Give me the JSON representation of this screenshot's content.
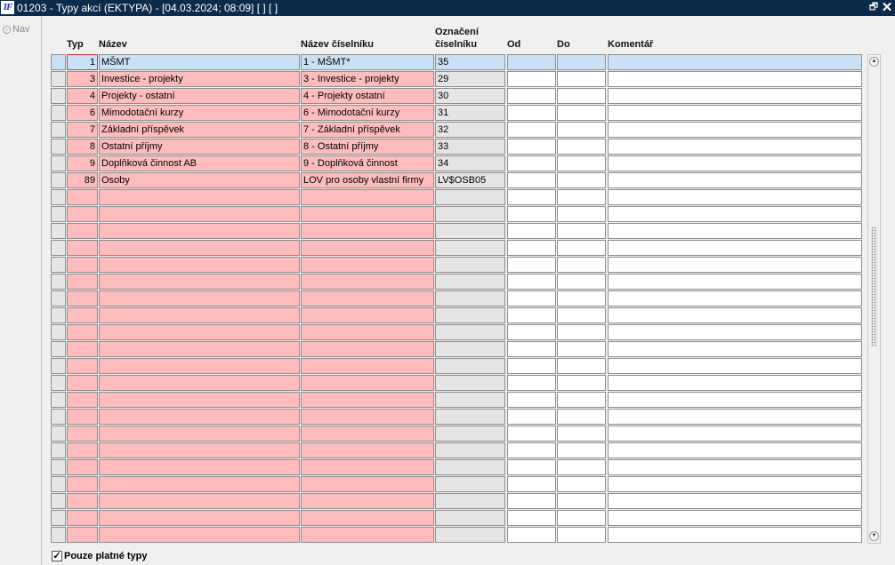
{
  "window": {
    "logo_text": "IF",
    "title": "01203 - Typy akcí (EKTYPA) - [04.03.2024; 08:09]  [ ]  [ ]",
    "restore_glyph": "🗗",
    "close_glyph": "✕"
  },
  "left_panel": {
    "nav_label": "Nav"
  },
  "columns": {
    "typ": "Typ",
    "nazev": "Název",
    "nazev_ciselniku": "Název číselníku",
    "oznaceni_line1": "Označení",
    "oznaceni_line2": "číselníku",
    "od": "Od",
    "do": "Do",
    "komentar": "Komentář"
  },
  "rows": [
    {
      "typ": "1",
      "nazev": "MŠMT",
      "ciselnik": "1 - MŠMT*",
      "oznaceni": "35",
      "od": "",
      "do": "",
      "komentar": ""
    },
    {
      "typ": "3",
      "nazev": "Investice - projekty",
      "ciselnik": "3 - Investice - projekty",
      "oznaceni": "29",
      "od": "",
      "do": "",
      "komentar": ""
    },
    {
      "typ": "4",
      "nazev": "Projekty - ostatní",
      "ciselnik": "4 - Projekty ostatní",
      "oznaceni": "30",
      "od": "",
      "do": "",
      "komentar": ""
    },
    {
      "typ": "6",
      "nazev": "Mimodotační kurzy",
      "ciselnik": "6 - Mimodotační kurzy",
      "oznaceni": "31",
      "od": "",
      "do": "",
      "komentar": ""
    },
    {
      "typ": "7",
      "nazev": "Základní příspěvek",
      "ciselnik": "7 - Základní příspěvek",
      "oznaceni": "32",
      "od": "",
      "do": "",
      "komentar": ""
    },
    {
      "typ": "8",
      "nazev": "Ostatní příjmy",
      "ciselnik": "8 - Ostatní příjmy",
      "oznaceni": "33",
      "od": "",
      "do": "",
      "komentar": ""
    },
    {
      "typ": "9",
      "nazev": "Doplňková činnost AB",
      "ciselnik": "9 - Doplňková činnost",
      "oznaceni": "34",
      "od": "",
      "do": "",
      "komentar": ""
    },
    {
      "typ": "89",
      "nazev": "Osoby",
      "ciselnik": "LOV pro osoby vlastní firmy",
      "oznaceni": "LV$OSB05",
      "od": "",
      "do": "",
      "komentar": ""
    }
  ],
  "total_rows": 29,
  "current_row": 0,
  "footer": {
    "checkbox_label": "Pouze platné typy",
    "checked": true,
    "check_glyph": "✓"
  },
  "scrollbar": {
    "up_glyph": "▲",
    "down_glyph": "▼"
  },
  "colors": {
    "titlebar": "#0c2a4a",
    "mandatory_field": "#ffbcbc",
    "readonly_field": "#e5e5e5",
    "current_row": "#c9e1f6",
    "focus_border": "#d9342b"
  }
}
